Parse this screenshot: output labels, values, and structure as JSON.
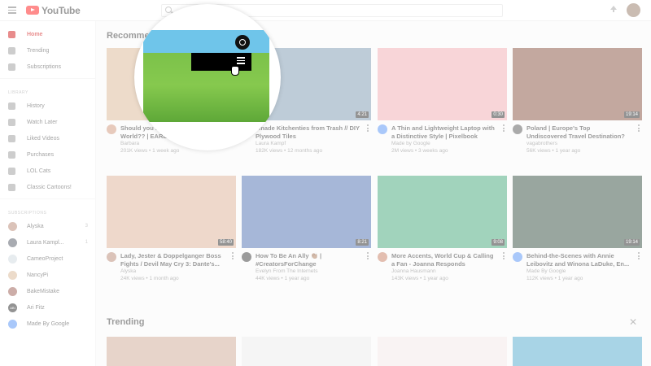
{
  "app": {
    "logo_text": "YouTube"
  },
  "sidebar": {
    "nav": [
      {
        "label": "Home",
        "icon": "home-icon",
        "active": true
      },
      {
        "label": "Trending",
        "icon": "trending-icon"
      },
      {
        "label": "Subscriptions",
        "icon": "subscriptions-icon"
      }
    ],
    "library_heading": "LIBRARY",
    "library": [
      {
        "label": "History",
        "icon": "history-icon"
      },
      {
        "label": "Watch Later",
        "icon": "watch-later-icon"
      },
      {
        "label": "Liked Videos",
        "icon": "liked-videos-icon"
      },
      {
        "label": "Purchases",
        "icon": "purchases-icon"
      },
      {
        "label": "LOL Cats",
        "icon": "playlist-icon"
      },
      {
        "label": "Classic Cartoons!",
        "icon": "playlist-icon"
      }
    ],
    "subscriptions_heading": "SUBSCRIPTIONS",
    "subscriptions": [
      {
        "label": "Alyska",
        "count": "3",
        "color": "#b07a64"
      },
      {
        "label": "Laura Kampl...",
        "count": "1",
        "color": "#3f4652"
      },
      {
        "label": "CameoProject",
        "count": "",
        "color": "#cbd4dc"
      },
      {
        "label": "NancyPi",
        "count": "",
        "color": "#d4b08a"
      },
      {
        "label": "BakeMistake",
        "count": "",
        "color": "#8f4a3f"
      },
      {
        "label": "Ari Fitz",
        "count": "",
        "color": "#111111",
        "text": "ABI"
      },
      {
        "label": "Made By Google",
        "count": "",
        "color": "#4285f4"
      }
    ]
  },
  "main": {
    "recommended_title": "Recommended",
    "trending_title": "Trending",
    "videos": [
      {
        "title": "Should you buy Hoa in Early World?? | EARLY IMPRESSIONS",
        "channel": "Barbara",
        "stats": "201K views • 1 week ago",
        "duration": "",
        "thumb": "#d8b08a",
        "av": "#c98a6a"
      },
      {
        "title": "I made Kitchenties from Trash // DIY Plywood Tiles",
        "channel": "Laura Kampf",
        "stats": "182K views • 12 months ago",
        "duration": "4:21",
        "thumb": "#6f8fa8",
        "av": "#3f4652"
      },
      {
        "title": "A Thin and Lightweight Laptop with a Distinctive Style | Pixelbook",
        "channel": "Made by Google",
        "stats": "2M views • 3 weeks ago",
        "duration": "0:30",
        "thumb": "#f0a3a8",
        "av": "#4285f4"
      },
      {
        "title": "Poland | Europe's Top Undiscovered Travel Destination?",
        "channel": "vagabrothers",
        "stats": "56K views • 1 year ago",
        "duration": "19:14",
        "thumb": "#7a3f2a",
        "av": "#444444"
      },
      {
        "title": "Lady, Jester & Doppelganger Boss Fights / Devil May Cry 3: Dante's...",
        "channel": "Alyska",
        "stats": "24K views • 1 month ago",
        "duration": "58:40",
        "thumb": "#d9a98c",
        "av": "#b07a64"
      },
      {
        "title": "How To Be An Ally 👏🏾 | #CreatorsForChange",
        "channel": "Evelyn From The Internets",
        "stats": "44K views • 1 year ago",
        "duration": "8:21",
        "thumb": "#3a5fa8",
        "av": "#222222"
      },
      {
        "title": "More Accents, World Cup & Calling a Fan - Joanna Responds",
        "channel": "Joanna Hausmann",
        "stats": "143K views • 1 year ago",
        "duration": "9:08",
        "thumb": "#2f9e6a",
        "av": "#c07050"
      },
      {
        "title": "Behind-the-Scenes with Annie Leibovitz and Winona LaDuke, En...",
        "channel": "Made By Google",
        "stats": "112K views • 1 year ago",
        "duration": "19:14",
        "thumb": "#1e3a2a",
        "av": "#4285f4"
      }
    ],
    "trending_thumbs": [
      "#c9a08a",
      "#e8e8e8",
      "#f2e4e4",
      "#3fa0c8"
    ]
  },
  "focus": {
    "tooltip_bar": ""
  }
}
